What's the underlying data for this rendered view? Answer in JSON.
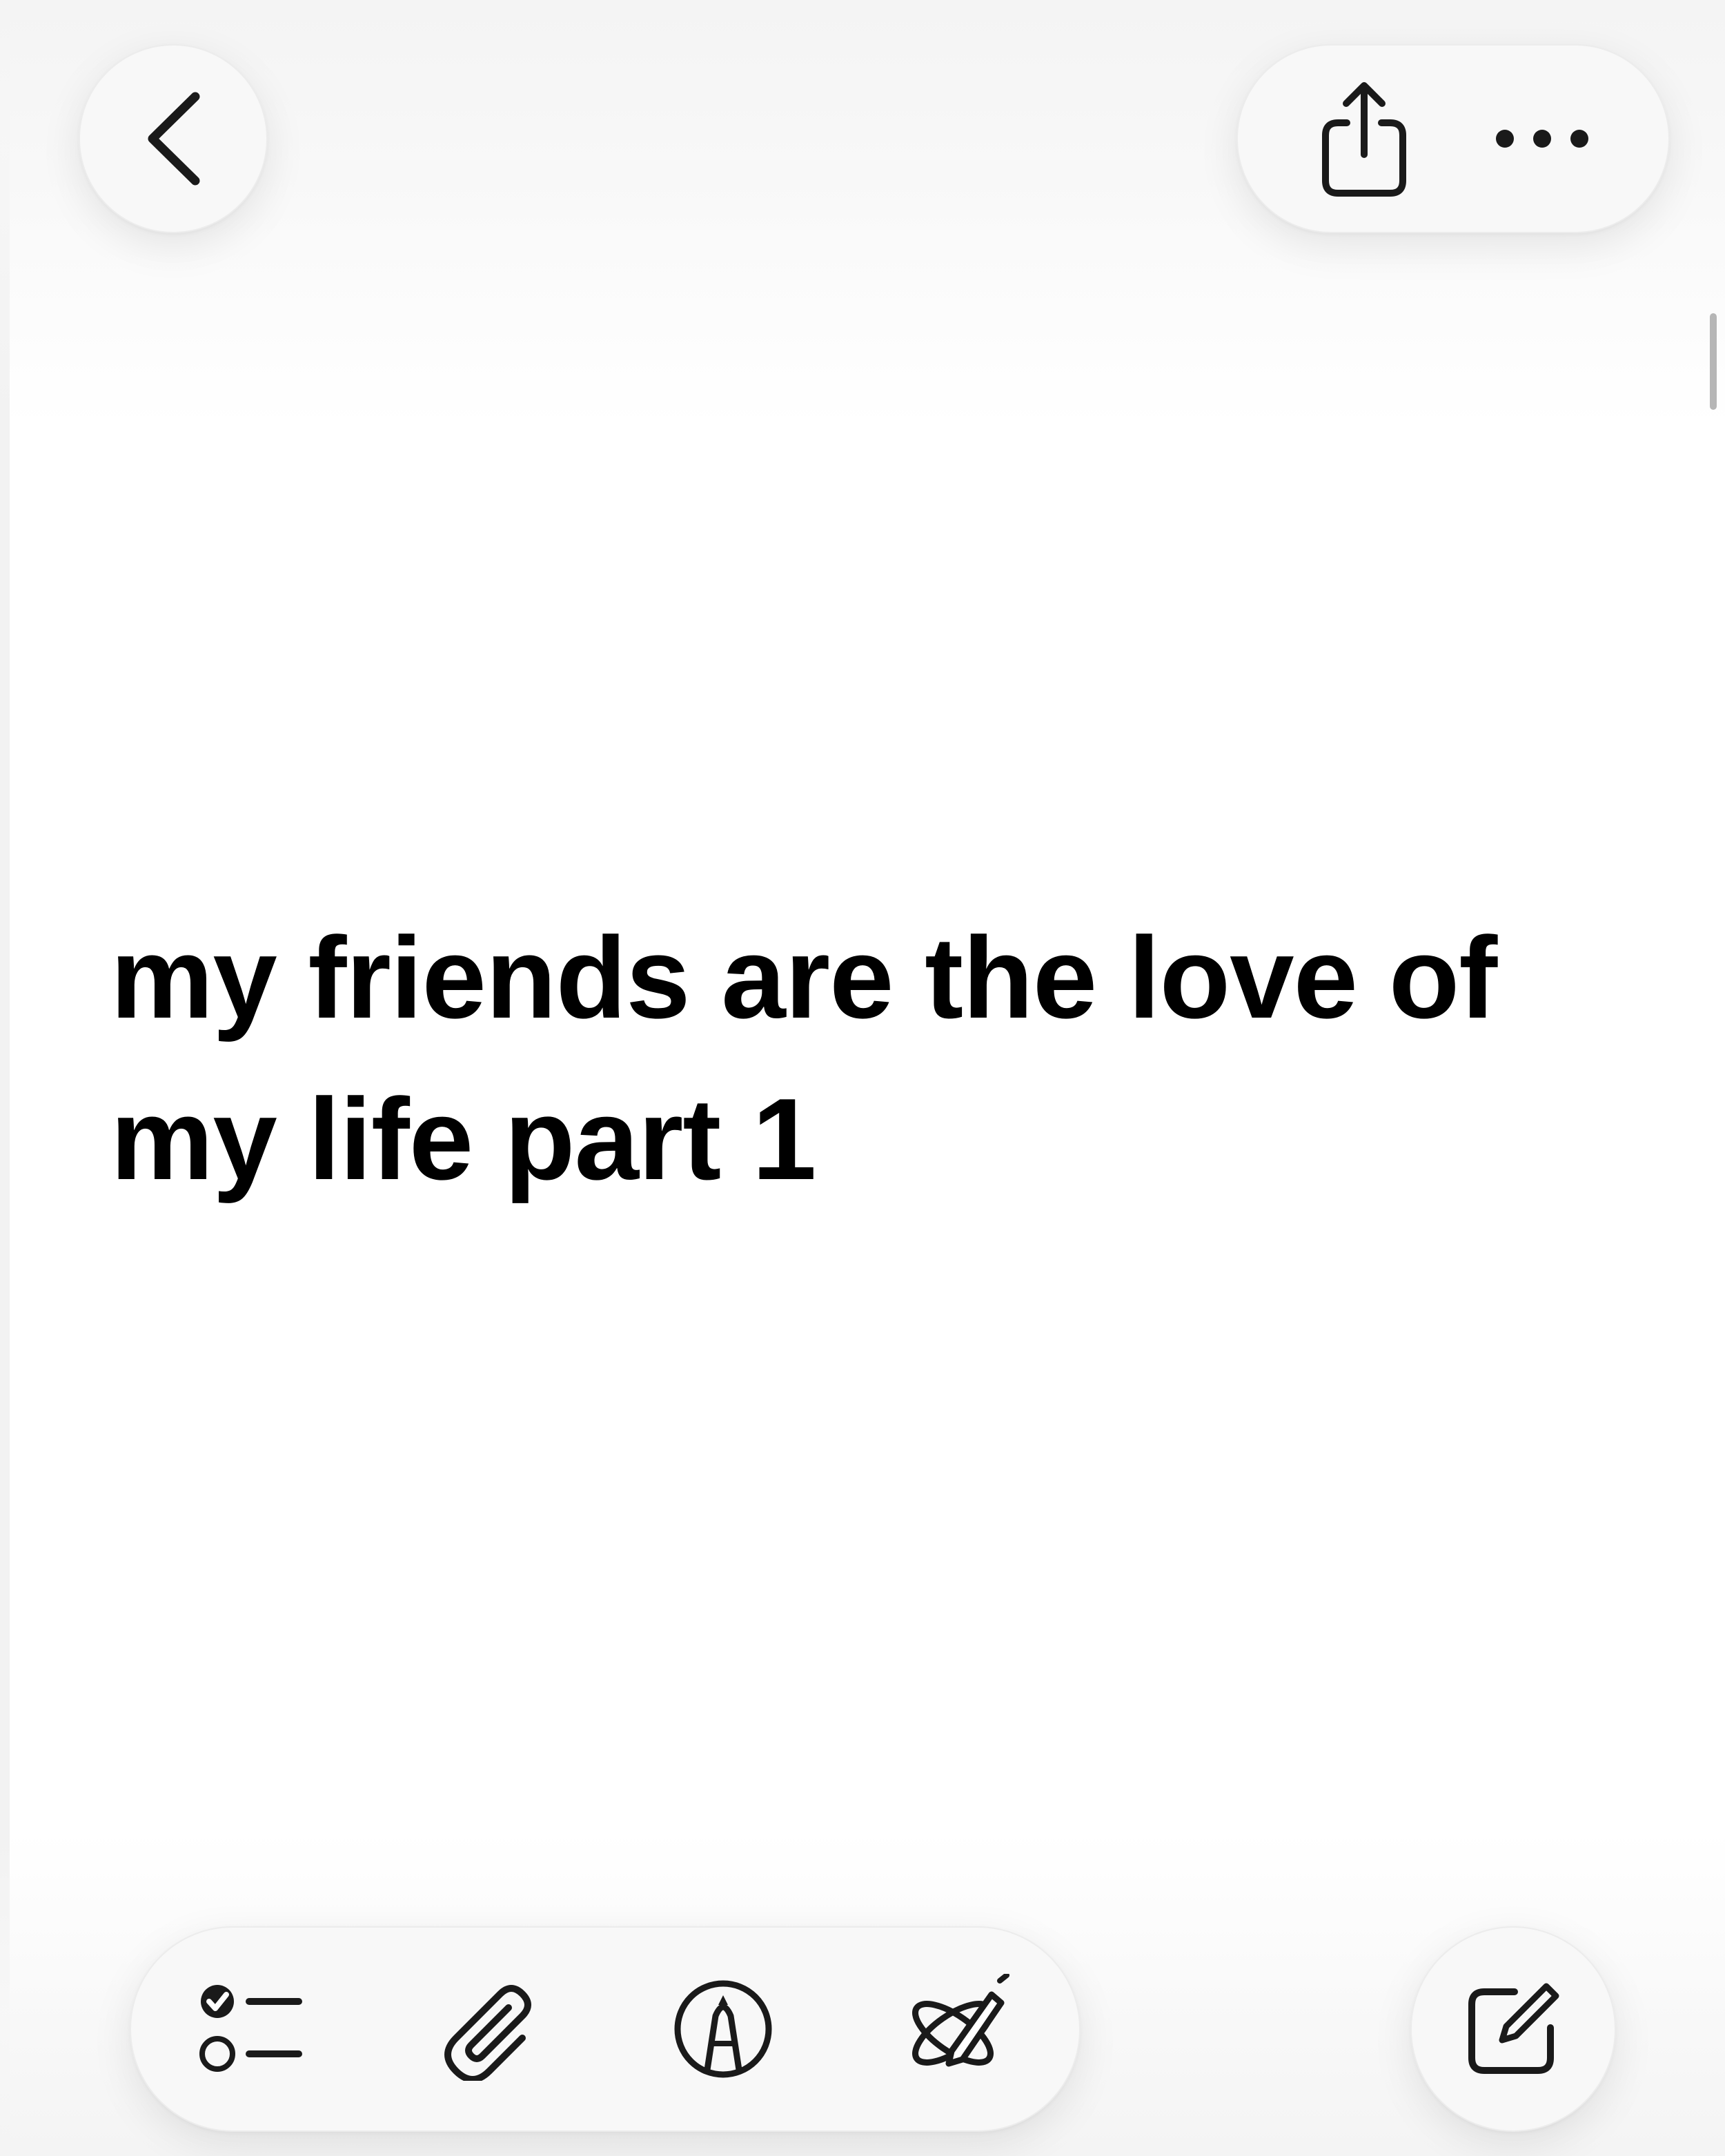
{
  "note": {
    "title": "my friends are the love of my life part 1"
  },
  "icons": {
    "back": "chevron-left-icon",
    "share": "share-icon",
    "more": "ellipsis-icon",
    "checklist": "checklist-icon",
    "attachment": "paperclip-icon",
    "markup": "markup-pen-icon",
    "writing_tools": "writing-tools-icon",
    "compose": "compose-icon"
  },
  "colors": {
    "background": "#ffffff",
    "text": "#000000",
    "button_fill": "#f8f8f8",
    "icon": "#1a1a1a"
  }
}
